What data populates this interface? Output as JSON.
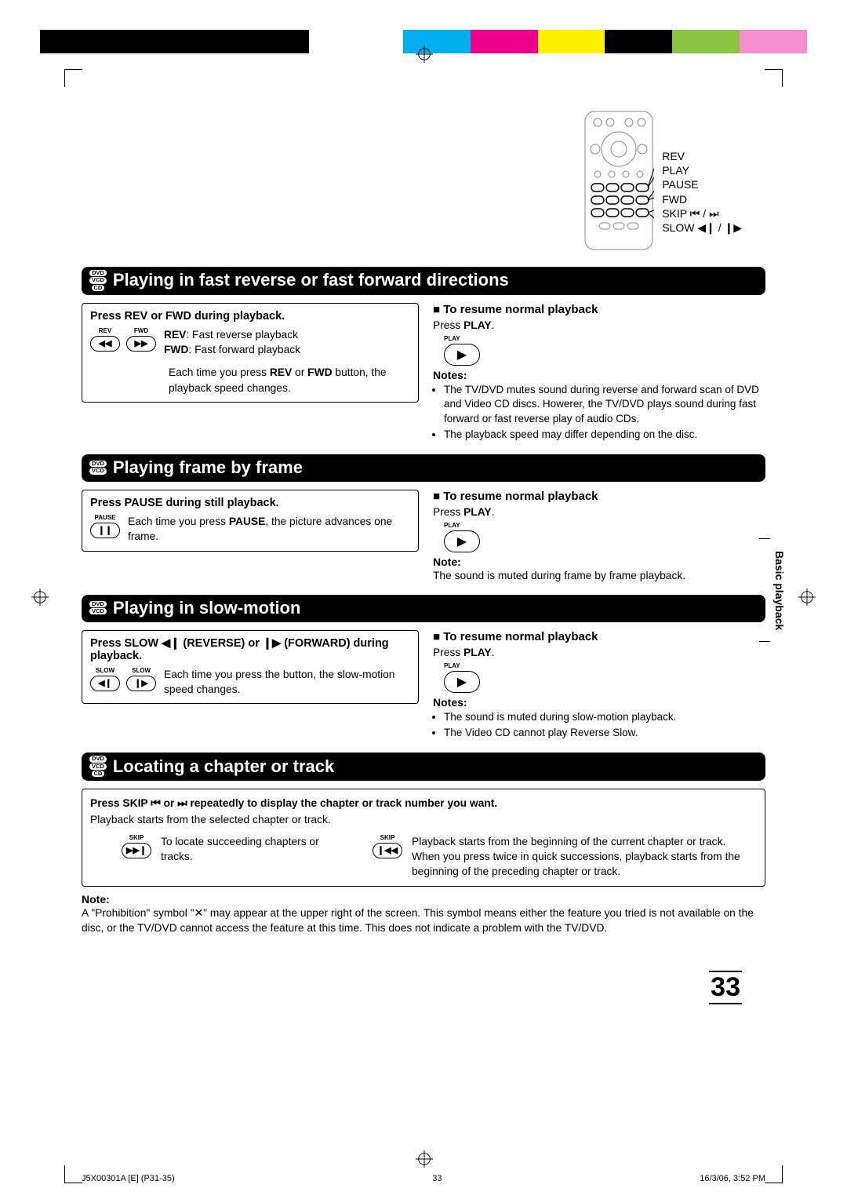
{
  "printer_marks": {
    "colors": [
      "#000",
      "#000",
      "#000",
      "#000",
      "#fff",
      "#fff",
      "#00aeef",
      "#ec008c",
      "#fff200",
      "#000",
      "#89c540",
      "#f48ecd",
      "#fff"
    ]
  },
  "remote": {
    "labels": [
      "REV",
      "PLAY",
      "PAUSE",
      "FWD",
      "SKIP ⏮ / ⏭",
      "SLOW ◀❙ / ❙▶"
    ]
  },
  "side_tab": "Basic playback",
  "page_number": "33",
  "footer": {
    "doc": "J5X00301A [E] (P31-35)",
    "page": "33",
    "date": "16/3/06, 3:52 PM"
  },
  "sections": [
    {
      "discs": [
        "DVD",
        "VCD",
        "CD"
      ],
      "title": "Playing in fast reverse or fast forward directions",
      "left": {
        "head": "Press REV or FWD during playback.",
        "buttons": [
          {
            "top": "REV",
            "glyph": "◀◀"
          },
          {
            "top": "FWD",
            "glyph": "▶▶"
          }
        ],
        "lines_html": "<b>REV</b>:  Fast reverse playback<br><b>FWD</b>: Fast forward playback",
        "extra": "Each time you press <b>REV</b> or <b>FWD</b> button, the playback speed changes."
      },
      "right": {
        "resume_head": "To resume normal playback",
        "resume_body": "Press <b>PLAY</b>.",
        "notes_head": "Notes:",
        "notes": [
          "The TV/DVD mutes sound during reverse and forward scan of DVD and Video CD discs. Howerer, the TV/DVD plays sound during fast forward or fast reverse play of audio CDs.",
          "The playback speed may differ depending on the disc."
        ]
      }
    },
    {
      "discs": [
        "DVD",
        "VCD"
      ],
      "title": "Playing frame by frame",
      "left": {
        "head": "Press PAUSE during still playback.",
        "buttons": [
          {
            "top": "PAUSE",
            "glyph": "❙❙"
          }
        ],
        "lines_html": "Each time you press <b>PAUSE</b>, the picture advances one frame."
      },
      "right": {
        "resume_head": "To resume normal playback",
        "resume_body": "Press <b>PLAY</b>.",
        "notes_head": "Note:",
        "notes_plain": "The sound is muted during frame by frame playback."
      }
    },
    {
      "discs": [
        "DVD",
        "VCD"
      ],
      "title": "Playing in slow-motion",
      "left": {
        "head_html": "Press SLOW ◀❙ (REVERSE) or  ❙▶ (FORWARD) during playback.",
        "buttons": [
          {
            "top": "SLOW",
            "glyph": "◀❙"
          },
          {
            "top": "SLOW",
            "glyph": "❙▶"
          }
        ],
        "lines_html": "Each time you press the button, the slow-motion speed changes."
      },
      "right": {
        "resume_head": "To resume normal playback",
        "resume_body": "Press <b>PLAY</b>.",
        "notes_head": "Notes:",
        "notes": [
          "The sound is muted during slow-motion playback.",
          "The Video CD cannot play Reverse Slow."
        ]
      }
    },
    {
      "discs": [
        "DVD",
        "VCD",
        "CD"
      ],
      "title": "Locating a chapter or track",
      "full": {
        "head_html": "Press SKIP ⏮ or ⏭ repeatedly to display the chapter or track number you want.",
        "sub": "Playback starts from the selected chapter or track.",
        "items": [
          {
            "btn": {
              "top": "SKIP",
              "glyph": "▶▶❙"
            },
            "text": "To locate succeeding chapters or tracks."
          },
          {
            "btn": {
              "top": "SKIP",
              "glyph": "❙◀◀"
            },
            "text": "Playback starts from the beginning of the current chapter or track.<br>When you press twice in quick successions, playback starts from the beginning of the preceding chapter or track."
          }
        ]
      }
    }
  ],
  "end_note": {
    "head": "Note:",
    "body": "A \"Prohibition\" symbol \"✕\" may appear at the upper right of the screen. This symbol means either the feature you tried is not available on the disc, or the TV/DVD cannot access the feature at this time. This does not indicate a problem with the TV/DVD."
  }
}
